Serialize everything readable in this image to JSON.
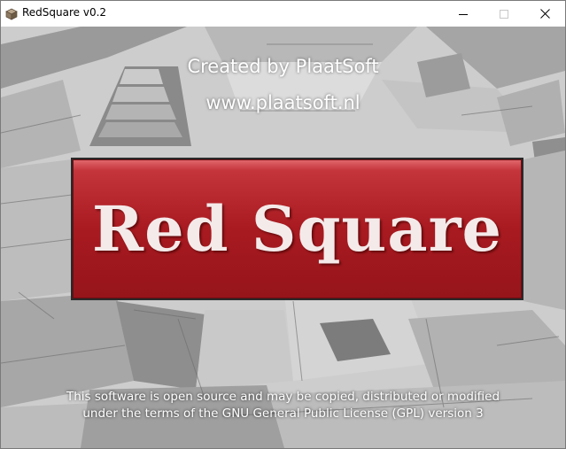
{
  "window": {
    "title": "RedSquare v0.2",
    "icons": {
      "app": "app-cube-icon",
      "minimize": "minimize-icon",
      "maximize": "maximize-icon",
      "close": "close-icon"
    }
  },
  "splash": {
    "credit": "Created by PlaatSoft",
    "website": "www.plaatsoft.nl",
    "logo_text": "Red Square",
    "license_line1": "This software is open source and may be copied, distributed or modified",
    "license_line2": "under the terms of the GNU General Public License (GPL) version 3"
  },
  "colors": {
    "logo_red": "#a81a20",
    "logo_text": "#f4eaea",
    "text": "#ffffff"
  }
}
